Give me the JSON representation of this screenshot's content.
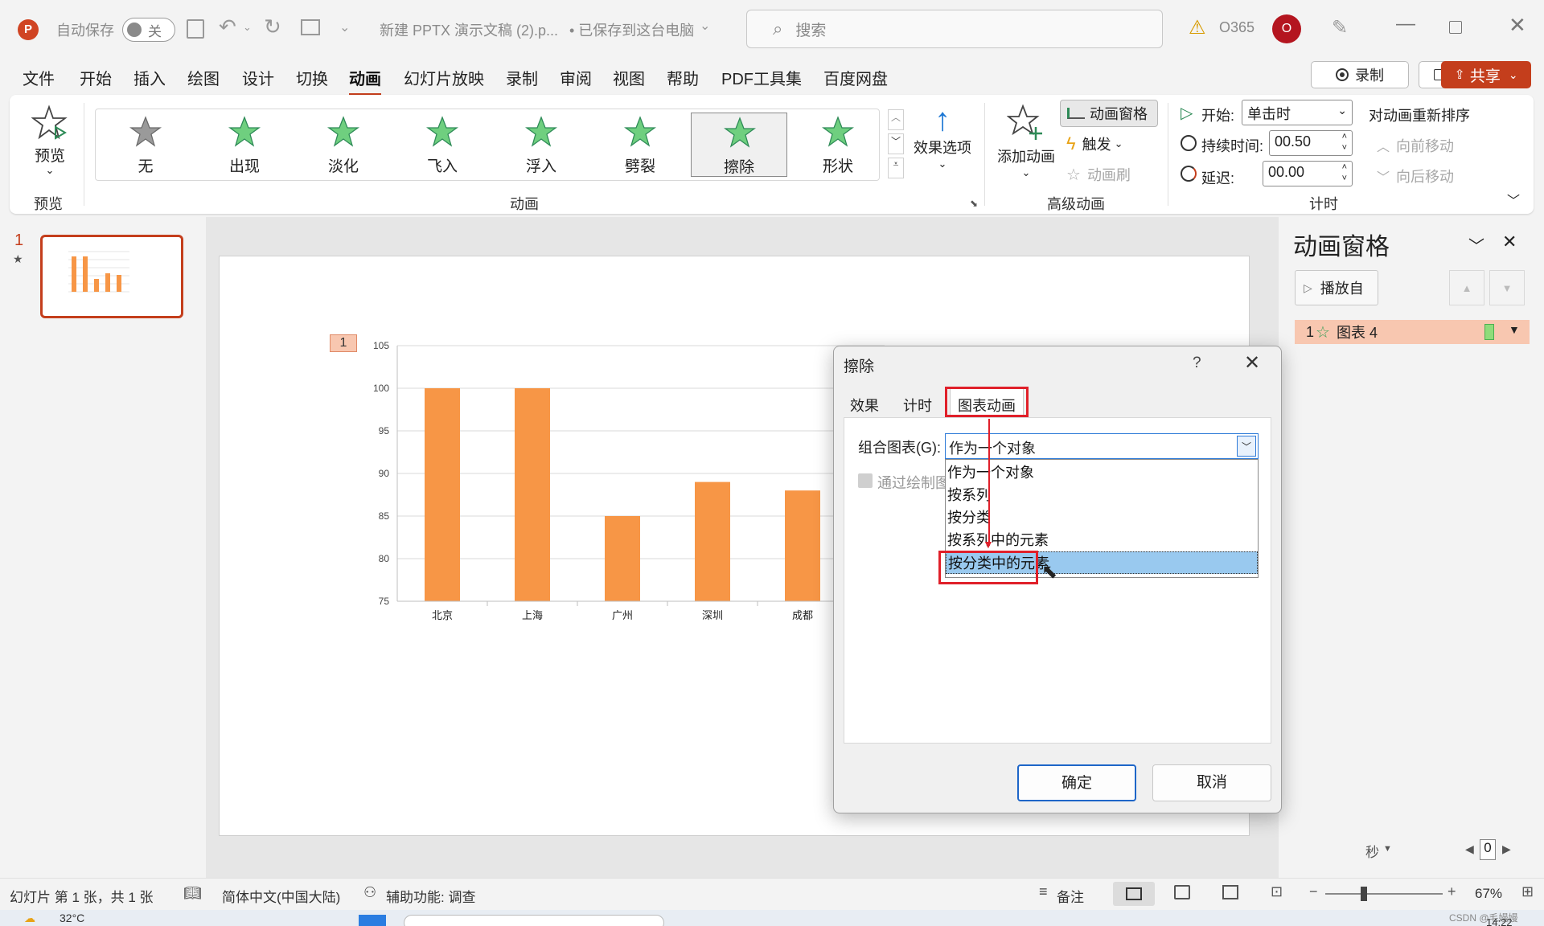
{
  "titlebar": {
    "autosave_label": "自动保存",
    "autosave_toggle": "关",
    "doc_title": "新建 PPTX 演示文稿 (2).p...",
    "save_status": "• 已保存到这台电脑",
    "search_placeholder": "搜索",
    "account_label": "O365",
    "avatar_letter": "O"
  },
  "menu": {
    "items": [
      "文件",
      "开始",
      "插入",
      "绘图",
      "设计",
      "切换",
      "动画",
      "幻灯片放映",
      "录制",
      "审阅",
      "视图",
      "帮助",
      "PDF工具集",
      "百度网盘"
    ],
    "active": "动画",
    "record_btn": "录制",
    "share_btn": "共享"
  },
  "ribbon": {
    "preview_label": "预览",
    "preview_group": "预览",
    "animations": [
      "无",
      "出现",
      "淡化",
      "飞入",
      "浮入",
      "劈裂",
      "擦除",
      "形状"
    ],
    "selected_animation": "擦除",
    "animation_group": "动画",
    "effect_options": "效果选项",
    "add_animation": "添加动画",
    "anim_pane_btn": "动画窗格",
    "trigger_btn": "触发",
    "anim_painter": "动画刷",
    "advanced_group": "高级动画",
    "start_label": "开始:",
    "start_value": "单击时",
    "duration_label": "持续时间:",
    "duration_value": "00.50",
    "delay_label": "延迟:",
    "delay_value": "00.00",
    "timing_group": "计时",
    "reorder_title": "对动画重新排序",
    "move_earlier": "向前移动",
    "move_later": "向后移动"
  },
  "thumbnail": {
    "number": "1"
  },
  "chart_data": {
    "type": "bar",
    "categories": [
      "北京",
      "上海",
      "广州",
      "深圳",
      "成都"
    ],
    "values": [
      100,
      100,
      85,
      89,
      88
    ],
    "ylim": [
      75,
      105
    ],
    "yticks": [
      75,
      80,
      85,
      90,
      95,
      100,
      105
    ],
    "title": "",
    "xlabel": "",
    "ylabel": "",
    "grid": true,
    "color": "#f79646",
    "animation_tag": "1"
  },
  "dialog": {
    "title": "擦除",
    "help": "?",
    "tabs": [
      "效果",
      "计时",
      "图表动画"
    ],
    "active_tab": "图表动画",
    "group_chart_label": "组合图表(G):",
    "group_chart_value": "作为一个对象",
    "checkbox_label": "通过绘制图",
    "options": [
      "作为一个对象",
      "按系列",
      "按分类",
      "按系列中的元素",
      "按分类中的元素"
    ],
    "selected_option": "按分类中的元素",
    "ok": "确定",
    "cancel": "取消"
  },
  "anim_pane": {
    "title": "动画窗格",
    "play_from": "播放自",
    "item_index": "1",
    "item_label": "图表 4",
    "seconds_label": "秒",
    "page_num": "0"
  },
  "statusbar": {
    "slide_info": "幻灯片 第 1 张，共 1 张",
    "language": "简体中文(中国大陆)",
    "accessibility": "辅助功能: 调查",
    "notes": "备注",
    "zoom": "67%"
  },
  "taskbar": {
    "weather": "32°C",
    "watermark": "CSDN @毛嫚嫚",
    "time": "14:22"
  }
}
